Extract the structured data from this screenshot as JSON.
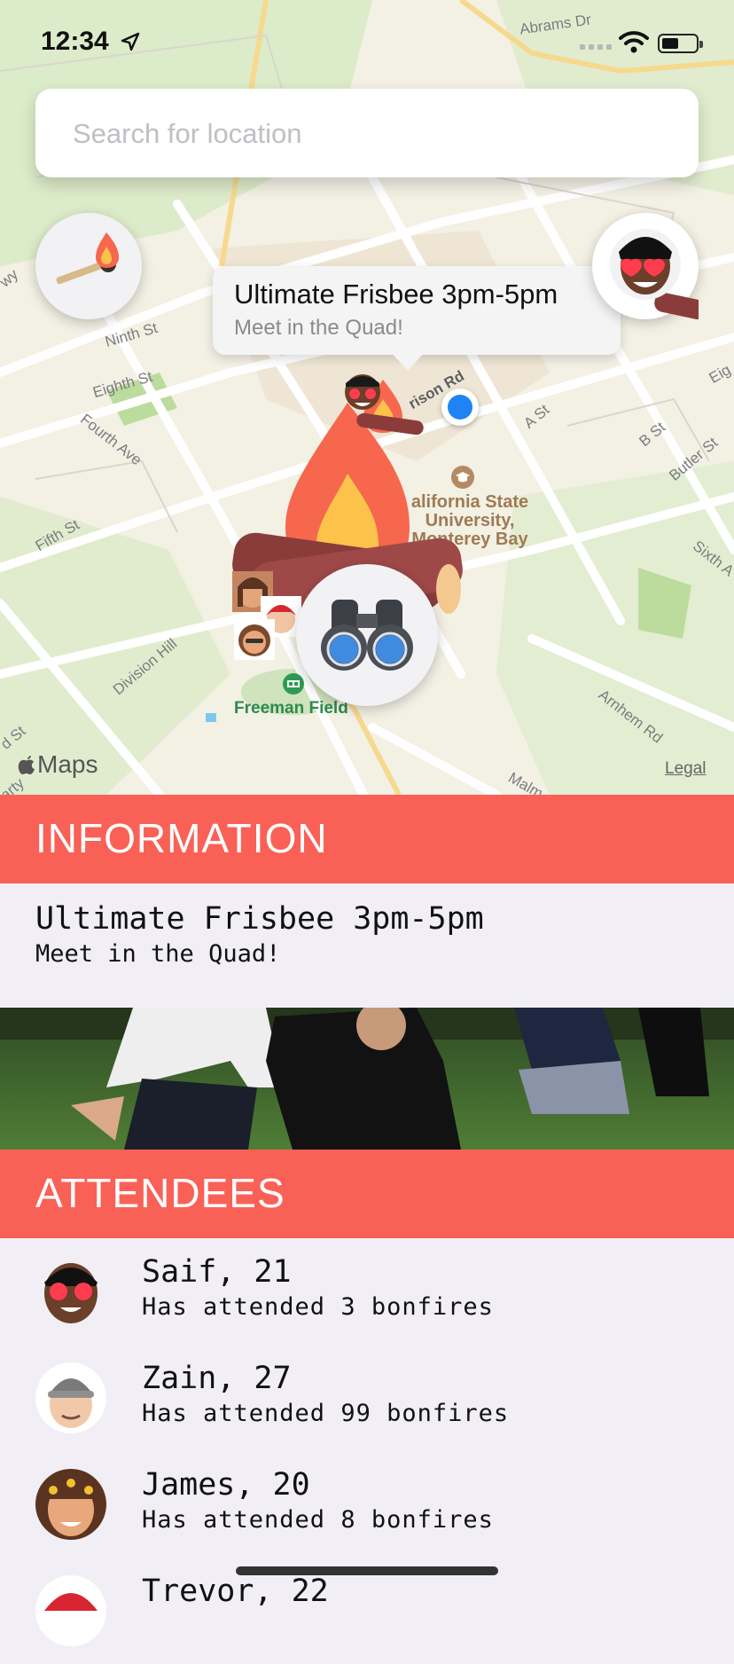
{
  "status_bar": {
    "time": "12:34"
  },
  "search": {
    "placeholder": "Search for location"
  },
  "callout": {
    "title": "Ultimate Frisbee 3pm-5pm",
    "subtitle": "Meet in the Quad!"
  },
  "map": {
    "streets": [
      "Abrams Dr",
      "Ninth St",
      "Eighth St",
      "Fourth Ave",
      "Fifth St",
      "Division Hill",
      "A St",
      "B St",
      "Butler St",
      "Sixth A",
      "Arnhem Rd",
      "Malm",
      "rison Rd",
      "Eig",
      "wy",
      "d St",
      "arty"
    ],
    "poi": "California State University, Monterey Bay",
    "poi_lines": [
      "alifornia State",
      "University,",
      "Monterey Bay"
    ],
    "field": "Freeman Field",
    "attribution": "Maps",
    "legal": "Legal"
  },
  "information": {
    "header": "INFORMATION",
    "title": "Ultimate Frisbee 3pm-5pm",
    "subtitle": "Meet in the Quad!"
  },
  "attendees": {
    "header": "ATTENDEES",
    "items": [
      {
        "name": "Saif, 21",
        "detail": "Has attended 3 bonfires",
        "avatar": "saif-avatar"
      },
      {
        "name": "Zain, 27",
        "detail": "Has attended 99 bonfires",
        "avatar": "zain-avatar"
      },
      {
        "name": "James, 20",
        "detail": "Has attended 8 bonfires",
        "avatar": "james-avatar"
      },
      {
        "name": "Trevor, 22",
        "detail": "",
        "avatar": "trevor-avatar"
      }
    ]
  },
  "colors": {
    "accent": "#f96157",
    "background": "#f1eff5",
    "location_dot": "#1f83f6"
  },
  "icons": [
    "location-arrow-icon",
    "signal-icon",
    "wifi-icon",
    "battery-icon",
    "match-icon",
    "binoculars-icon",
    "bonfire-icon",
    "apple-logo-icon"
  ]
}
